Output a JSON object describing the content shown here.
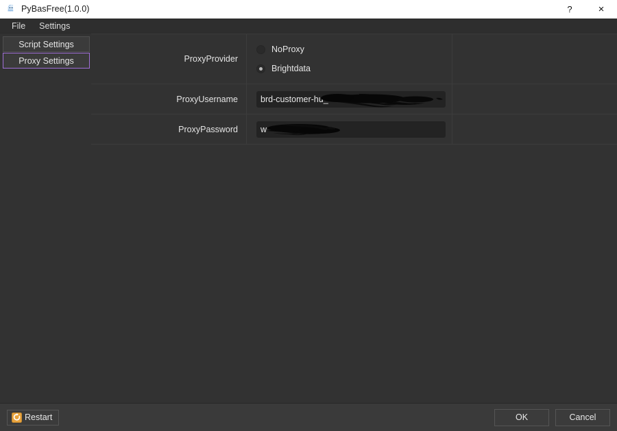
{
  "window": {
    "title": "PyBasFree(1.0.0)",
    "app_icon": "squid-app-icon",
    "help_label": "?",
    "close_label": "×"
  },
  "menubar": {
    "items": [
      {
        "label": "File"
      },
      {
        "label": "Settings"
      }
    ]
  },
  "sidebar": {
    "items": [
      {
        "label": "Script Settings",
        "selected": false
      },
      {
        "label": "Proxy Settings",
        "selected": true
      }
    ],
    "selected_accent": "#a06fd8"
  },
  "form": {
    "rows": [
      {
        "label": "ProxyProvider",
        "type": "radio-group",
        "options": [
          {
            "label": "NoProxy",
            "checked": false
          },
          {
            "label": "Brightdata",
            "checked": true
          }
        ]
      },
      {
        "label": "ProxyUsername",
        "type": "text",
        "value": "brd-customer-hu_",
        "redacted": true
      },
      {
        "label": "ProxyPassword",
        "type": "text",
        "value": "w",
        "redacted": true
      }
    ]
  },
  "bottombar": {
    "restart_label": "Restart",
    "restart_icon": "refresh-icon",
    "ok_label": "OK",
    "cancel_label": "Cancel"
  },
  "colors": {
    "titlebar_bg": "#ffffff",
    "window_bg": "#2e2e2e",
    "panel_bg": "#323232",
    "grid_line": "#3c3c3c",
    "input_bg": "#232323",
    "text": "#e4e4e4",
    "accent": "#a06fd8",
    "restart_icon": "#e8a33d"
  }
}
